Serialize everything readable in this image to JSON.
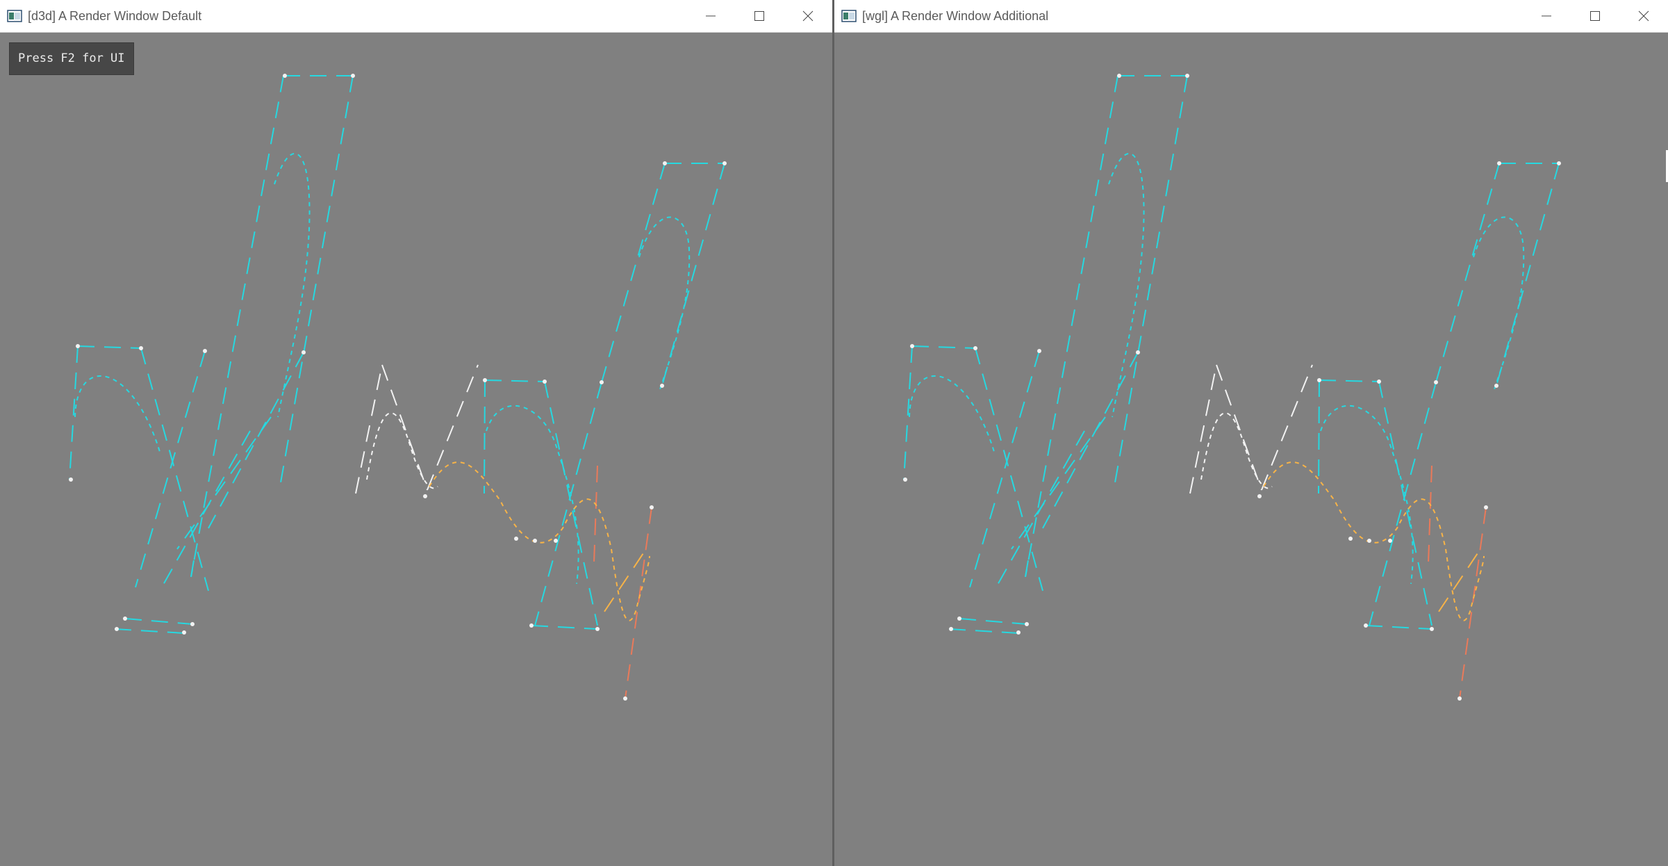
{
  "windows": [
    {
      "title": "[d3d] A Render Window Default",
      "controls": {
        "minimize": "minimize-icon",
        "maximize": "maximize-icon",
        "close": "close-icon"
      }
    },
    {
      "title": "[wgl] A Render Window Additional",
      "controls": {
        "minimize": "minimize-icon",
        "maximize": "maximize-icon",
        "close": "close-icon"
      }
    }
  ],
  "overlay": {
    "hint": "Press F2 for UI"
  },
  "colors": {
    "viewport_bg": "#808080",
    "cyan": "#26d8e0",
    "white": "#f2f2f2",
    "orange": "#f7b347",
    "coral": "#ea7a5a",
    "yellow": "#f4e060"
  }
}
